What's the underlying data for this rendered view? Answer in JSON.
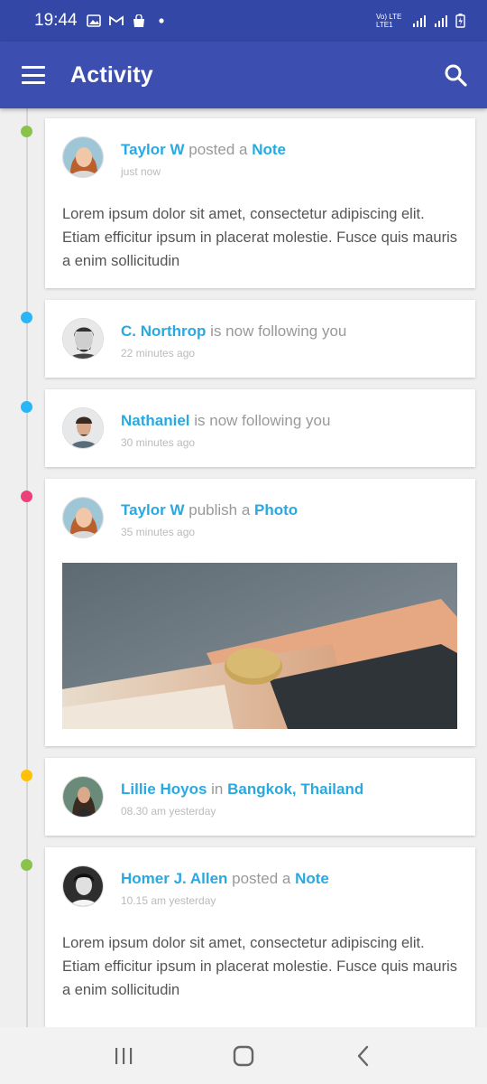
{
  "status_bar": {
    "time": "19:44",
    "network": "Vo) LTE LTE1"
  },
  "app_bar": {
    "title": "Activity"
  },
  "colors": {
    "primary": "#3c4eb0",
    "accent": "#29a9e1",
    "dot_green": "#8bc34a",
    "dot_blue": "#29b6f6",
    "dot_pink": "#ec407a",
    "dot_yellow": "#ffc107"
  },
  "feed": [
    {
      "name": "Taylor W",
      "action": " posted a ",
      "object": "Note",
      "time": "just now",
      "text": "Lorem ipsum dolor sit amet, consectetur adipiscing elit. Etiam efficitur ipsum in placerat molestie. Fusce quis mauris a enim sollicitudin",
      "dot": "green"
    },
    {
      "name": "C. Northrop",
      "action": " is now following you",
      "time": "22 minutes ago",
      "dot": "blue"
    },
    {
      "name": "Nathaniel",
      "action": " is now following you",
      "time": "30 minutes ago",
      "dot": "blue"
    },
    {
      "name": "Taylor W",
      "action": " publish a ",
      "object": "Photo",
      "time": "35 minutes ago",
      "dot": "pink"
    },
    {
      "name": "Lillie Hoyos",
      "action": " in ",
      "object": "Bangkok, Thailand",
      "time": "08.30 am yesterday",
      "dot": "yellow"
    },
    {
      "name": "Homer J. Allen",
      "action": " posted a ",
      "object": "Note",
      "time": "10.15 am yesterday",
      "text": "Lorem ipsum dolor sit amet, consectetur adipiscing elit. Etiam efficitur ipsum in placerat molestie. Fusce quis mauris a enim sollicitudin",
      "dot": "green"
    }
  ],
  "icons": {
    "menu": "menu-icon",
    "search": "search-icon",
    "recents": "recents-icon",
    "home": "home-icon",
    "back": "back-icon"
  }
}
